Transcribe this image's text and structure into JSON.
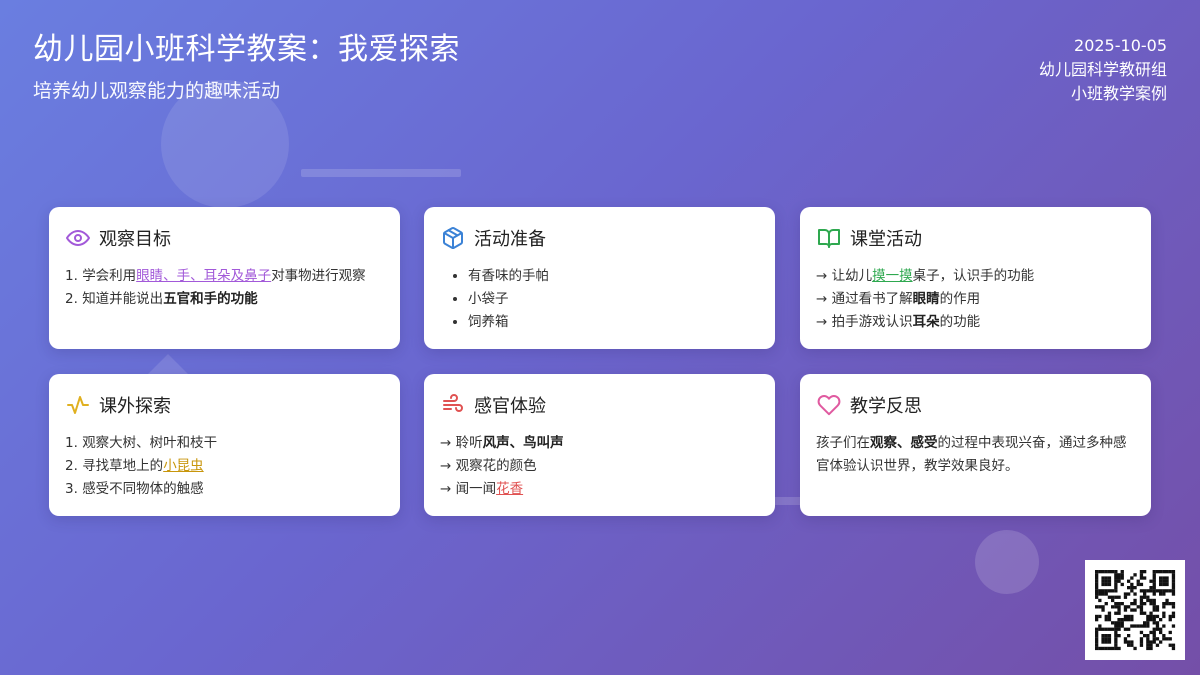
{
  "header": {
    "title": "幼儿园小班科学教案：我爱探索",
    "subtitle": "培养幼儿观察能力的趣味活动",
    "date": "2025-10-05",
    "author": "幼儿园科学教研组",
    "category": "小班教学案例"
  },
  "colors": {
    "observe": "#a259d9",
    "prepare": "#3b82d6",
    "classroom": "#2ea84f",
    "outdoor": "#e0b020",
    "senses": "#e05252",
    "reflect": "#e05aa0"
  },
  "cards": {
    "observe": {
      "icon": "eye-icon",
      "title": "观察目标",
      "items": [
        {
          "num": "1.",
          "pre": "学会利用",
          "hl": "眼睛、手、耳朵及鼻子",
          "post": "对事物进行观察"
        },
        {
          "num": "2.",
          "pre": "知道并能说出",
          "bold": "五官和手的功能"
        }
      ]
    },
    "prepare": {
      "icon": "box-icon",
      "title": "活动准备",
      "items": [
        "有香味的手帕",
        "小袋子",
        "饲养箱"
      ]
    },
    "classroom": {
      "icon": "book-open-icon",
      "title": "课堂活动",
      "items": [
        {
          "pre": "→ 让幼儿",
          "hl": "摸一摸",
          "post": "桌子，认识手的功能"
        },
        {
          "pre": "→ 通过看书了解",
          "bold": "眼睛",
          "post": "的作用"
        },
        {
          "pre": "→ 拍手游戏认识",
          "bold": "耳朵",
          "post": "的功能"
        }
      ]
    },
    "outdoor": {
      "icon": "activity-icon",
      "title": "课外探索",
      "items": [
        {
          "num": "1.",
          "pre": "观察大树、树叶和枝干"
        },
        {
          "num": "2.",
          "pre": "寻找草地上的",
          "hl": "小昆虫"
        },
        {
          "num": "3.",
          "pre": "感受不同物体的触感"
        }
      ]
    },
    "senses": {
      "icon": "wind-icon",
      "title": "感官体验",
      "items": [
        {
          "pre": "→ 聆听",
          "bold": "风声、鸟叫声"
        },
        {
          "pre": "→ 观察花的颜色"
        },
        {
          "pre": "→ 闻一闻",
          "hl": "花香"
        }
      ]
    },
    "reflect": {
      "icon": "heart-icon",
      "title": "教学反思",
      "pre": "孩子们在",
      "bold": "观察、感受",
      "post": "的过程中表现兴奋，通过多种感官体验认识世界，教学效果良好。"
    }
  }
}
